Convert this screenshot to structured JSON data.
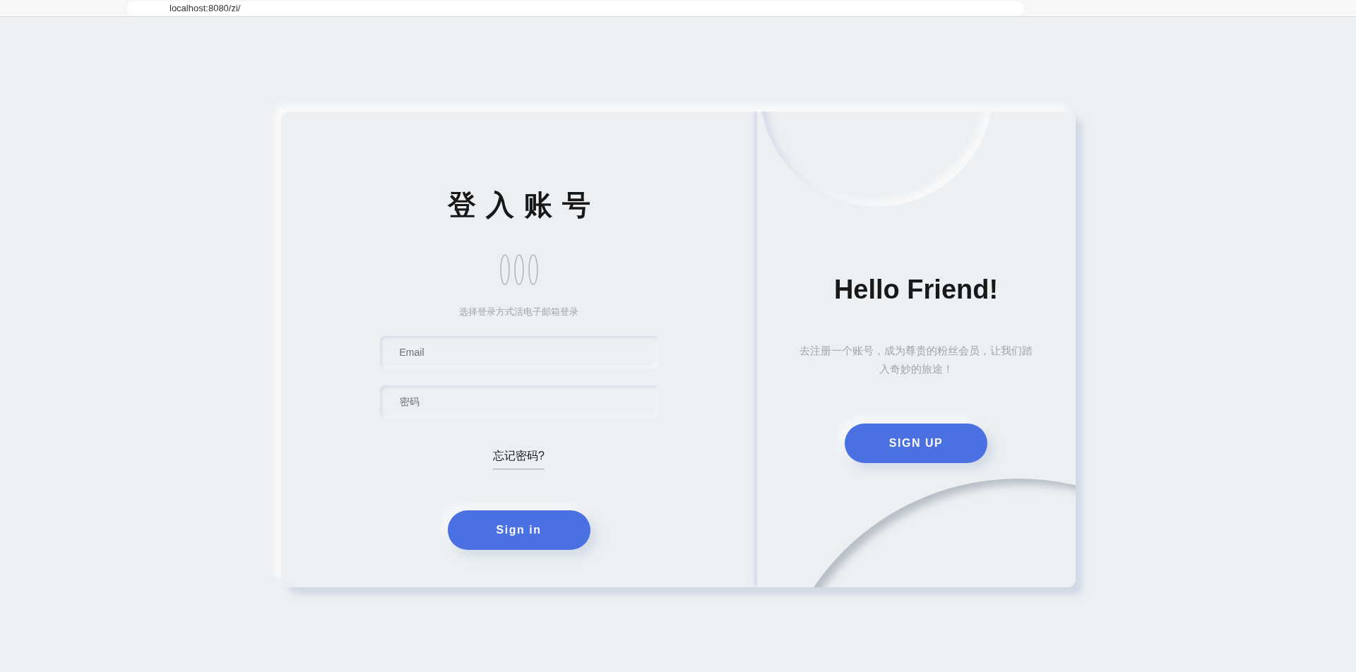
{
  "browser": {
    "url": "localhost:8080/zi/"
  },
  "login": {
    "title": "登入账号",
    "social_icons": [
      {
        "kind": "oval"
      },
      {
        "kind": "oval"
      },
      {
        "kind": "oval"
      }
    ],
    "hint": "选择登录方式活电子邮箱登录",
    "fields": [
      {
        "placeholder": "Email"
      },
      {
        "placeholder": "密码"
      }
    ],
    "forgot_link": "忘记密码?",
    "button": "Sign in"
  },
  "signup": {
    "title": "Hello Friend!",
    "text": "去注册一个账号，成为尊贵的粉丝会员，让我们踏入奇妙的旅途！",
    "button": "SIGN UP"
  }
}
